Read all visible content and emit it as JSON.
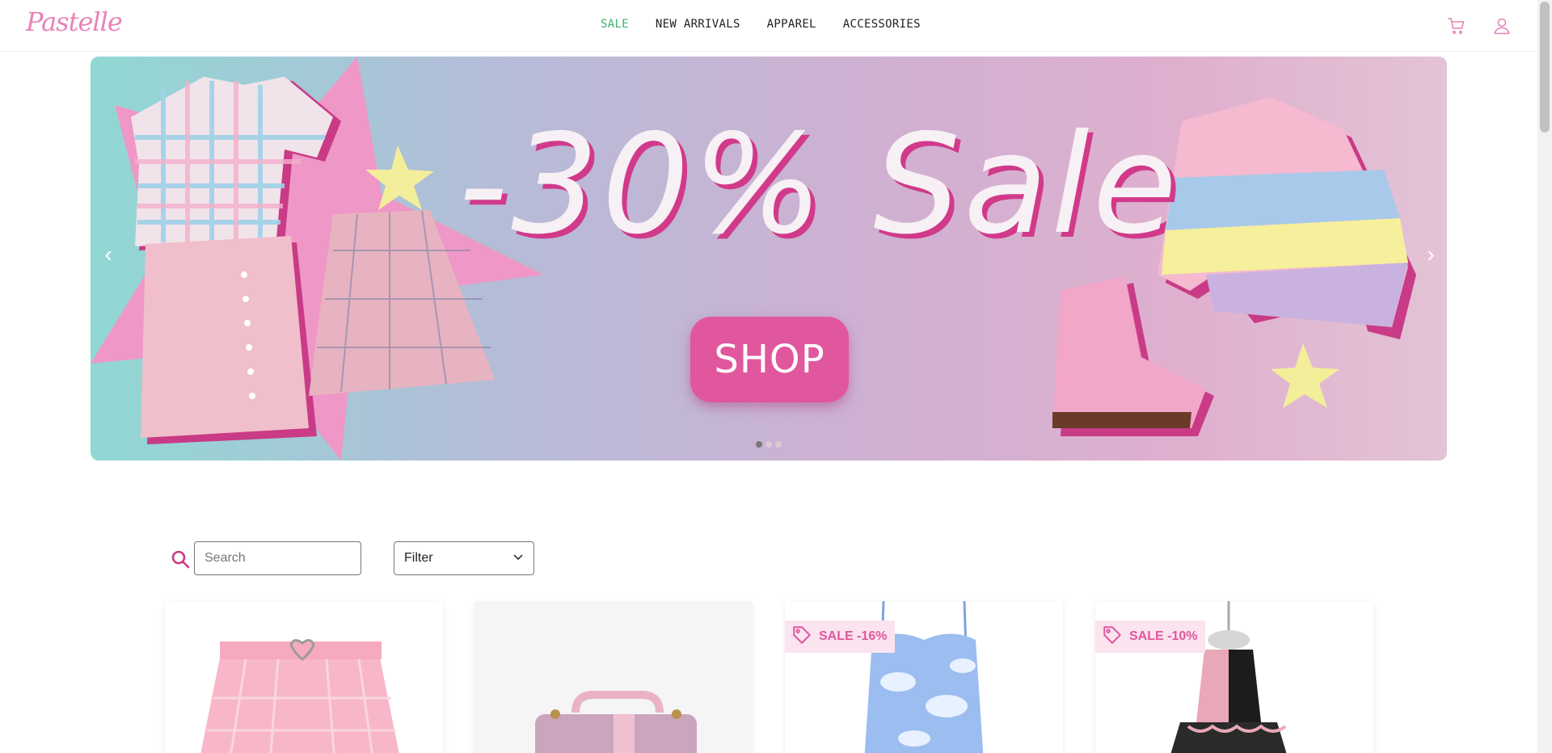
{
  "brand": {
    "logo_text": "Pastelle",
    "accent": "#e882b8",
    "active_nav": "#3db26b",
    "sale_pink": "#e0579e"
  },
  "nav": {
    "links": [
      {
        "label": "SALE",
        "active": true
      },
      {
        "label": "NEW ARRIVALS",
        "active": false
      },
      {
        "label": "APPAREL",
        "active": false
      },
      {
        "label": "ACCESSORIES",
        "active": false
      }
    ],
    "icons": [
      "cart-icon",
      "user-icon"
    ]
  },
  "hero": {
    "headline": "-30% Sale",
    "cta_label": "SHOP",
    "prev_arrow": "‹",
    "next_arrow": "›",
    "slides_count": 3,
    "active_slide": 1
  },
  "search": {
    "placeholder": "Search",
    "icon": "search-icon"
  },
  "filter": {
    "label": "Filter",
    "icon": "chevron-down-icon"
  },
  "products": [
    {
      "badge": "",
      "art": "pink-plaid-skirt"
    },
    {
      "badge": "",
      "art": "lilac-handbag"
    },
    {
      "badge": "SALE -16%",
      "art": "cloud-print-dress"
    },
    {
      "badge": "SALE -10%",
      "art": "pink-black-lolita-dress"
    }
  ]
}
